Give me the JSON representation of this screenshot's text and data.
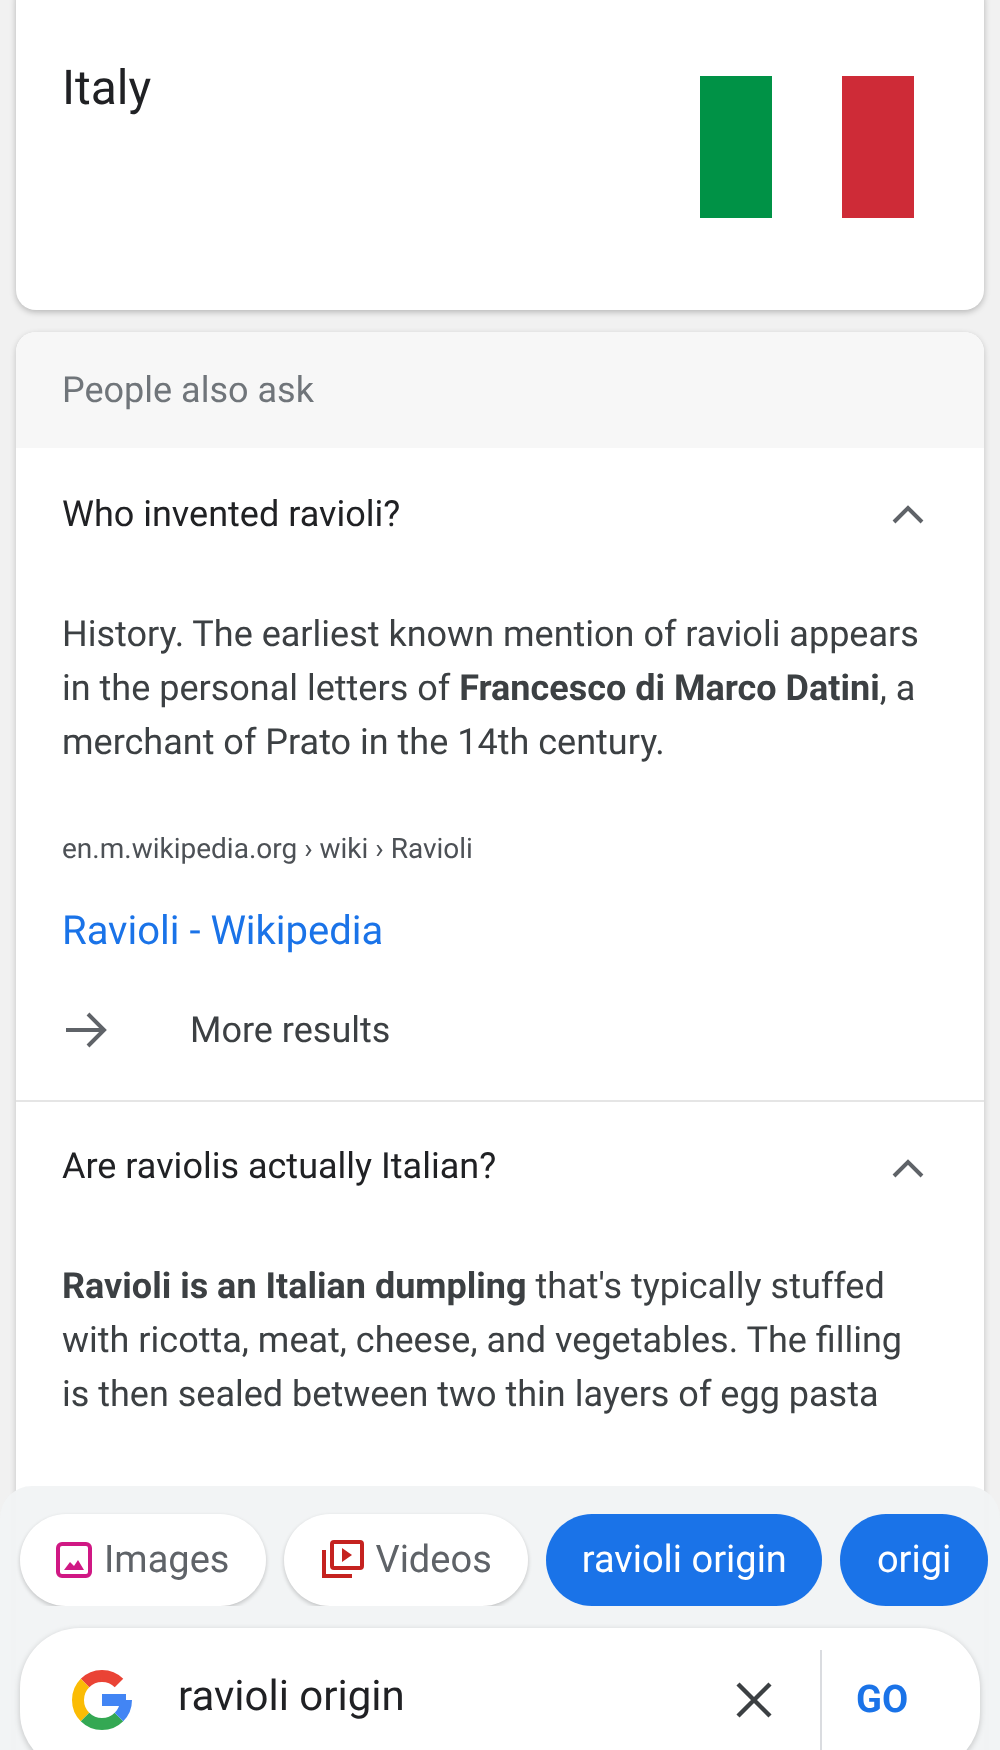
{
  "country_card": {
    "title": "Italy"
  },
  "people_also_ask": {
    "heading": "People also ask",
    "questions": [
      {
        "question": "Who invented ravioli?",
        "expanded": true,
        "answer": "History. The earliest known mention of ravioli appears in the personal letters of **Francesco di Marco Datini**, a merchant of Prato in the 14th century.",
        "source": "en.m.wikipedia.org › wiki › Ravioli",
        "link": "Ravioli - Wikipedia",
        "more": "More results"
      },
      {
        "question": "Are raviolis actually Italian?",
        "expanded": true,
        "answer": "**Ravioli is an Italian dumpling** that's typically stuffed with ricotta, meat, cheese, and vegetables. The filling is then sealed between two thin layers of egg pasta"
      }
    ]
  },
  "chips": [
    {
      "kind": "images",
      "label": "Images"
    },
    {
      "kind": "videos",
      "label": "Videos"
    },
    {
      "kind": "suggestion",
      "label": "ravioli origin"
    },
    {
      "kind": "suggestion",
      "label": "origi"
    }
  ],
  "search": {
    "value": "ravioli origin",
    "go": "GO"
  }
}
